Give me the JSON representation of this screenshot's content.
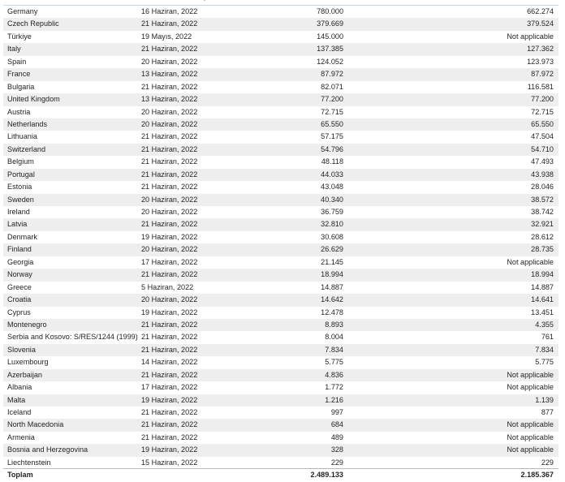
{
  "rows": [
    {
      "country": "Germany",
      "date": "16 Haziran, 2022",
      "v1": "780.000",
      "v2": "662.274"
    },
    {
      "country": "Czech Republic",
      "date": "21 Haziran, 2022",
      "v1": "379.669",
      "v2": "379.524"
    },
    {
      "country": "Türkiye",
      "date": "19 Mayıs, 2022",
      "v1": "145.000",
      "v2": "Not applicable"
    },
    {
      "country": "Italy",
      "date": "21 Haziran, 2022",
      "v1": "137.385",
      "v2": "127.362"
    },
    {
      "country": "Spain",
      "date": "20 Haziran, 2022",
      "v1": "124.052",
      "v2": "123.973"
    },
    {
      "country": "France",
      "date": "13 Haziran, 2022",
      "v1": "87.972",
      "v2": "87.972"
    },
    {
      "country": "Bulgaria",
      "date": "21 Haziran, 2022",
      "v1": "82.071",
      "v2": "116.581"
    },
    {
      "country": "United Kingdom",
      "date": "13 Haziran, 2022",
      "v1": "77.200",
      "v2": "77.200"
    },
    {
      "country": "Austria",
      "date": "20 Haziran, 2022",
      "v1": "72.715",
      "v2": "72.715"
    },
    {
      "country": "Netherlands",
      "date": "20 Haziran, 2022",
      "v1": "65.550",
      "v2": "65.550"
    },
    {
      "country": "Lithuania",
      "date": "21 Haziran, 2022",
      "v1": "57.175",
      "v2": "47.504"
    },
    {
      "country": "Switzerland",
      "date": "21 Haziran, 2022",
      "v1": "54.796",
      "v2": "54.710"
    },
    {
      "country": "Belgium",
      "date": "21 Haziran, 2022",
      "v1": "48.118",
      "v2": "47.493"
    },
    {
      "country": "Portugal",
      "date": "21 Haziran, 2022",
      "v1": "44.033",
      "v2": "43.938"
    },
    {
      "country": "Estonia",
      "date": "21 Haziran, 2022",
      "v1": "43.048",
      "v2": "28.046"
    },
    {
      "country": "Sweden",
      "date": "20 Haziran, 2022",
      "v1": "40.340",
      "v2": "38.572"
    },
    {
      "country": "Ireland",
      "date": "20 Haziran, 2022",
      "v1": "36.759",
      "v2": "38.742"
    },
    {
      "country": "Latvia",
      "date": "21 Haziran, 2022",
      "v1": "32.810",
      "v2": "32.921"
    },
    {
      "country": "Denmark",
      "date": "19 Haziran, 2022",
      "v1": "30.608",
      "v2": "28.612"
    },
    {
      "country": "Finland",
      "date": "20 Haziran, 2022",
      "v1": "26.629",
      "v2": "28.735"
    },
    {
      "country": "Georgia",
      "date": "17 Haziran, 2022",
      "v1": "21.145",
      "v2": "Not applicable"
    },
    {
      "country": "Norway",
      "date": "21 Haziran, 2022",
      "v1": "18.994",
      "v2": "18.994"
    },
    {
      "country": "Greece",
      "date": "5 Haziran, 2022",
      "v1": "14.887",
      "v2": "14.887"
    },
    {
      "country": "Croatia",
      "date": "20 Haziran, 2022",
      "v1": "14.642",
      "v2": "14.641"
    },
    {
      "country": "Cyprus",
      "date": "19 Haziran, 2022",
      "v1": "12.478",
      "v2": "13.451"
    },
    {
      "country": "Montenegro",
      "date": "21 Haziran, 2022",
      "v1": "8.893",
      "v2": "4.355"
    },
    {
      "country": "Serbia and Kosovo: S/RES/1244 (1999)",
      "date": "21 Haziran, 2022",
      "v1": "8.004",
      "v2": "761"
    },
    {
      "country": "Slovenia",
      "date": "21 Haziran, 2022",
      "v1": "7.834",
      "v2": "7.834"
    },
    {
      "country": "Luxembourg",
      "date": "14 Haziran, 2022",
      "v1": "5.775",
      "v2": "5.775"
    },
    {
      "country": "Azerbaijan",
      "date": "21 Haziran, 2022",
      "v1": "4.836",
      "v2": "Not applicable"
    },
    {
      "country": "Albania",
      "date": "17 Haziran, 2022",
      "v1": "1.772",
      "v2": "Not applicable"
    },
    {
      "country": "Malta",
      "date": "19 Haziran, 2022",
      "v1": "1.216",
      "v2": "1.139"
    },
    {
      "country": "Iceland",
      "date": "21 Haziran, 2022",
      "v1": "997",
      "v2": "877"
    },
    {
      "country": "North Macedonia",
      "date": "21 Haziran, 2022",
      "v1": "684",
      "v2": "Not applicable"
    },
    {
      "country": "Armenia",
      "date": "21 Haziran, 2022",
      "v1": "489",
      "v2": "Not applicable"
    },
    {
      "country": "Bosnia and Herzegovina",
      "date": "19 Haziran, 2022",
      "v1": "328",
      "v2": "Not applicable"
    },
    {
      "country": "Liechtenstein",
      "date": "15 Haziran, 2022",
      "v1": "229",
      "v2": "229"
    }
  ],
  "total": {
    "label": "Toplam",
    "v1": "2.489.133",
    "v2": "2.185.367"
  }
}
